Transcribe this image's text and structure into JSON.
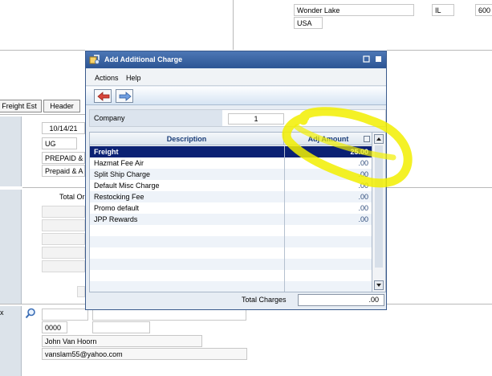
{
  "background": {
    "address": {
      "city": "Wonder Lake",
      "state": "IL",
      "zip_partial": "600",
      "country": "USA"
    },
    "buttons": {
      "freight_est": "Freight Est",
      "header": "Header"
    },
    "order_fields": {
      "date": "10/14/21",
      "ship_via": "UG",
      "terms1": "PREPAID &",
      "terms2": "Prepaid & A"
    },
    "total_label": "Total Or",
    "customer": {
      "field1": "0000",
      "name": "John Van Hoorn",
      "email": "vanslam55@yahoo.com"
    }
  },
  "dialog": {
    "title": "Add Additional Charge",
    "menu": {
      "actions": "Actions",
      "help": "Help"
    },
    "company_label": "Company",
    "company_value": "1",
    "columns": {
      "description": "Description",
      "adj_amount": "Adj Amount"
    },
    "rows": [
      {
        "description": "Freight",
        "amount": "25.00",
        "selected": true
      },
      {
        "description": "Hazmat Fee Air",
        "amount": ".00"
      },
      {
        "description": "Split Ship Charge",
        "amount": ".00"
      },
      {
        "description": "Default Misc Charge",
        "amount": ".00"
      },
      {
        "description": "Restocking Fee",
        "amount": ".00"
      },
      {
        "description": "Promo default",
        "amount": ".00"
      },
      {
        "description": "JPP Rewards",
        "amount": ".00"
      }
    ],
    "total_charges_label": "Total Charges",
    "total_charges_value": ".00"
  },
  "colors": {
    "title_bar": "#2c5594",
    "selected_row": "#0b2174",
    "highlight": "#ffff00"
  },
  "icons": [
    "app-icon",
    "back-arrow-icon",
    "forward-arrow-icon",
    "minimize-icon",
    "close-icon",
    "filter-icon",
    "scroll-up-icon",
    "scroll-down-icon",
    "search-icon"
  ]
}
